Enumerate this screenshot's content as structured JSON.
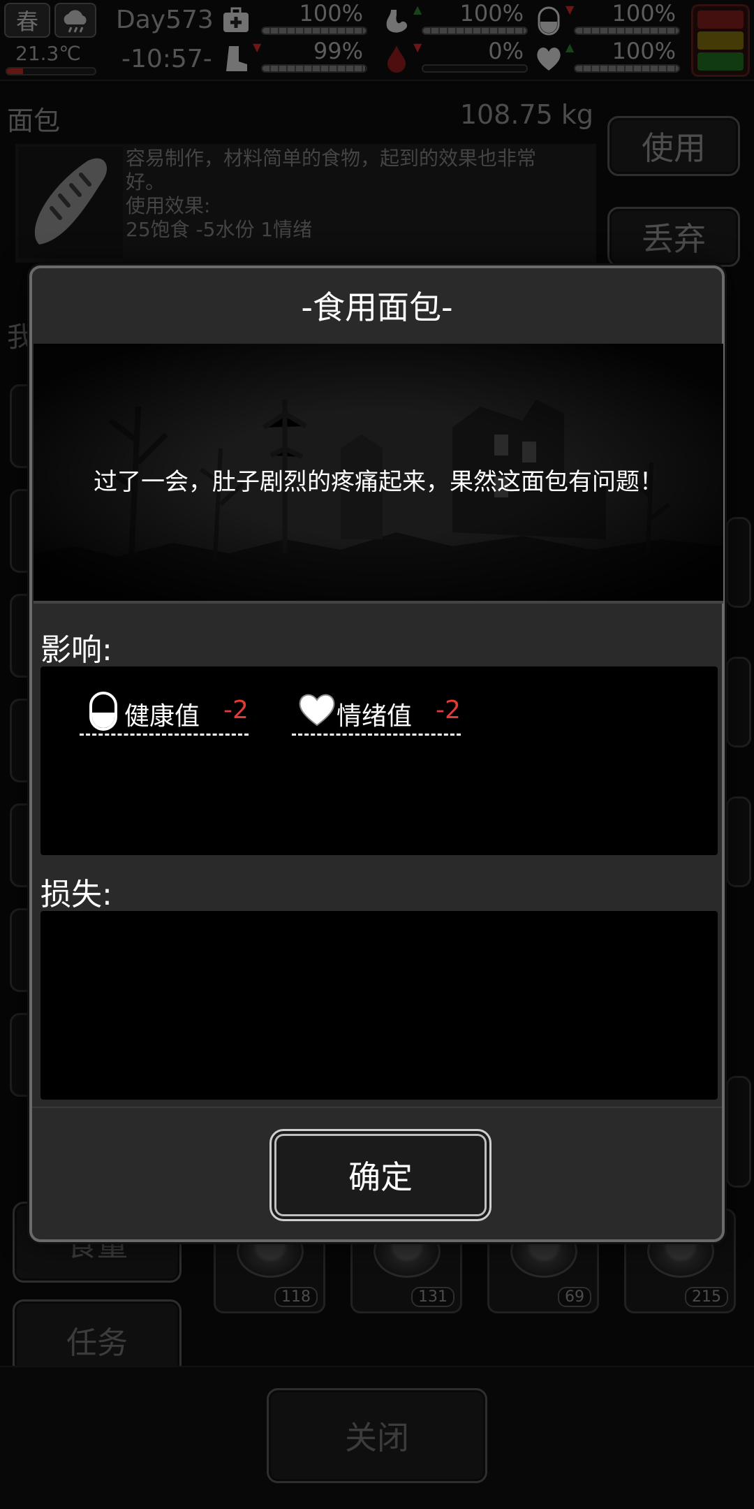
{
  "status": {
    "season": "春",
    "weather_icon": "cloud-icon",
    "temperature": "21.3℃",
    "temperature_level": 0.18,
    "day": "Day573",
    "time": "-10:57-",
    "stats": [
      {
        "name": "medkit-icon",
        "percent": "100%",
        "level": 1.0,
        "arrow": "none"
      },
      {
        "name": "stomach-icon",
        "percent": "100%",
        "level": 1.0,
        "arrow": "up"
      },
      {
        "name": "pill-icon",
        "percent": "100%",
        "level": 1.0,
        "arrow": "down"
      },
      {
        "name": "boot-icon",
        "percent": "99%",
        "level": 0.99,
        "arrow": "down"
      },
      {
        "name": "water-drop-icon",
        "percent": "0%",
        "level": 0.0,
        "arrow": "down"
      },
      {
        "name": "heart-icon",
        "percent": "100%",
        "level": 1.0,
        "arrow": "up"
      }
    ],
    "arrow_colors": {
      "up": "#2e7d32",
      "down": "#c62828"
    }
  },
  "item": {
    "name": "面包",
    "weight": "108.75 kg",
    "desc_line1": "容易制作，材料简单的食物，起到的效果也非常",
    "desc_line2": "好。",
    "desc_line3": "使用效果:",
    "desc_line4": "25饱食 -5水份 1情绪",
    "use_label": "使用",
    "discard_label": "丢弃"
  },
  "background": {
    "side_label_partial": "我",
    "food_label": "食量",
    "task_label": "任务",
    "close_label": "关闭",
    "slot_counts": [
      "118",
      "131",
      "69",
      "215"
    ]
  },
  "dialog": {
    "title": "-食用面包-",
    "scene_text": "过了一会，肚子剧烈的疼痛起来，果然这面包有问题！",
    "impact_label": "影响:",
    "loss_label": "损失:",
    "effects": [
      {
        "icon": "pill-icon",
        "label": "健康值",
        "value": "-2"
      },
      {
        "icon": "heart-icon",
        "label": "情绪值",
        "value": "-2"
      }
    ],
    "confirm_label": "确定",
    "value_color": "#e53935"
  },
  "colors": {
    "traffic_red": "#7a1c1c",
    "traffic_yellow": "#7a6a10",
    "traffic_green": "#1f6a1f"
  }
}
